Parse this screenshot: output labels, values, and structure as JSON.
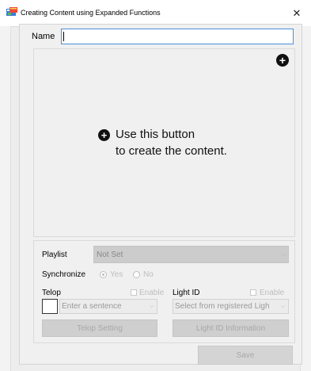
{
  "window": {
    "title": "Creating Content using Expanded Functions",
    "close_glyph": "✕",
    "app_icon": "app-window-icon"
  },
  "name": {
    "label": "Name",
    "value": "",
    "placeholder": ""
  },
  "content": {
    "add_icon": "plus-circle-icon",
    "hint_line1": "Use this button",
    "hint_line2": "to create the content."
  },
  "playlist": {
    "label": "Playlist",
    "selected": "Not Set",
    "enabled": false
  },
  "synchronize": {
    "label": "Synchronize",
    "options": [
      "Yes",
      "No"
    ],
    "selected": "Yes",
    "enabled": false
  },
  "telop": {
    "label": "Telop",
    "enable_label": "Enable",
    "enable_checked": false,
    "select_placeholder": "Enter a sentence",
    "setting_button": "Telop Setting"
  },
  "light_id": {
    "label": "Light ID",
    "enable_label": "Enable",
    "enable_checked": false,
    "select_placeholder": "Select from registered Ligh",
    "info_button": "Light ID Information"
  },
  "footer": {
    "save_label": "Save"
  },
  "colors": {
    "window_bg": "#ededed",
    "panel_bg": "#f0f0f0",
    "disabled_button": "#cfcfcf",
    "disabled_text": "#a8a8a8",
    "focus_border": "#4a90d9"
  }
}
